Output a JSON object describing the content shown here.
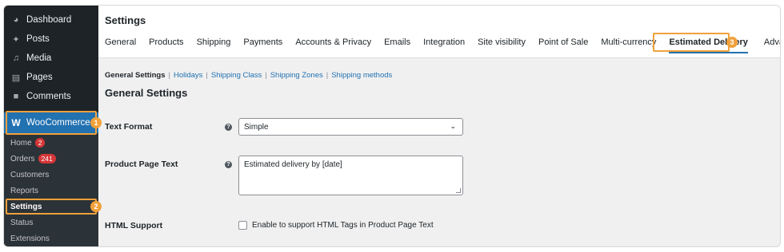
{
  "sidebar": {
    "items": [
      {
        "label": "Dashboard",
        "icon": "dashboard-icon"
      },
      {
        "label": "Posts",
        "icon": "pin-icon"
      },
      {
        "label": "Media",
        "icon": "media-icon"
      },
      {
        "label": "Pages",
        "icon": "pages-icon"
      },
      {
        "label": "Comments",
        "icon": "comment-icon"
      }
    ],
    "woocommerce": {
      "label": "WooCommerce",
      "icon": "woocommerce-icon"
    },
    "submenu": [
      {
        "label": "Home",
        "badge": "2"
      },
      {
        "label": "Orders",
        "badge": "241"
      },
      {
        "label": "Customers"
      },
      {
        "label": "Reports"
      },
      {
        "label": "Settings"
      },
      {
        "label": "Status"
      },
      {
        "label": "Extensions"
      }
    ]
  },
  "steps": [
    "1",
    "2",
    "3"
  ],
  "header": {
    "title": "Settings",
    "tabs": [
      "General",
      "Products",
      "Shipping",
      "Payments",
      "Accounts & Privacy",
      "Emails",
      "Integration",
      "Site visibility",
      "Point of Sale",
      "Multi-currency",
      "Estimated Delivery",
      "Advanced"
    ]
  },
  "sublinks": [
    "General Settings",
    "Holidays",
    "Shipping Class",
    "Shipping Zones",
    "Shipping methods"
  ],
  "section_title": "General Settings",
  "form": {
    "text_format": {
      "label": "Text Format",
      "value": "Simple"
    },
    "product_page_text": {
      "label": "Product Page Text",
      "value": "Estimated delivery by [date]"
    },
    "html_support": {
      "label": "HTML Support",
      "checkbox_label": "Enable to support HTML Tags in Product Page Text"
    }
  },
  "colors": {
    "accent": "#2271b1",
    "highlight": "#f0a13b",
    "sidebar": "#1d2327",
    "badge": "#d63638"
  }
}
